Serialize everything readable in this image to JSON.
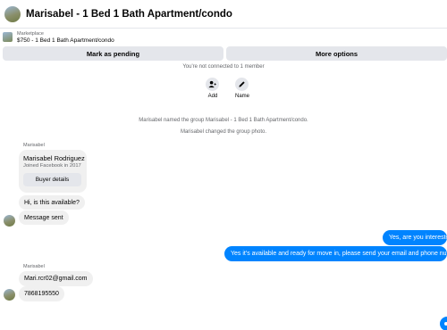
{
  "header": {
    "title": "Marisabel - 1 Bed 1 Bath Apartment/condo"
  },
  "listing": {
    "source": "Marketplace",
    "price_title": "$750 - 1 Bed 1 Bath Apartment/condo"
  },
  "actions": {
    "pending_label": "Mark as pending",
    "more_label": "More options"
  },
  "notices": {
    "not_connected": "You're not connected to 1 member",
    "named_group": "Marisabel named the group Marisabel - 1 Bed 1 Bath Apartment/condo.",
    "changed_photo": "Marisabel changed the group photo."
  },
  "group_actions": {
    "add_label": "Add",
    "name_label": "Name"
  },
  "thread": {
    "sender_name_1": "Marisabel",
    "card": {
      "name": "Marisabel Rodriguez",
      "joined": "Joined Facebook in 2017",
      "button": "Buyer details"
    },
    "msg_available": "Hi, is this available?",
    "msg_sent": "Message sent",
    "out_1": "Yes, are you interested?",
    "out_2": "Yes it's available and ready for move in, please send your email and phone number",
    "sender_name_2": "Marisabel",
    "msg_email": "Mari.rcr02@gmail.com",
    "msg_phone": "7868195550"
  },
  "colors": {
    "accent": "#0084ff",
    "bubble_in": "#f0f0f0",
    "button_bg": "#e4e6eb",
    "muted_text": "#65676b"
  },
  "icons": [
    "user-add-icon",
    "pencil-icon"
  ]
}
